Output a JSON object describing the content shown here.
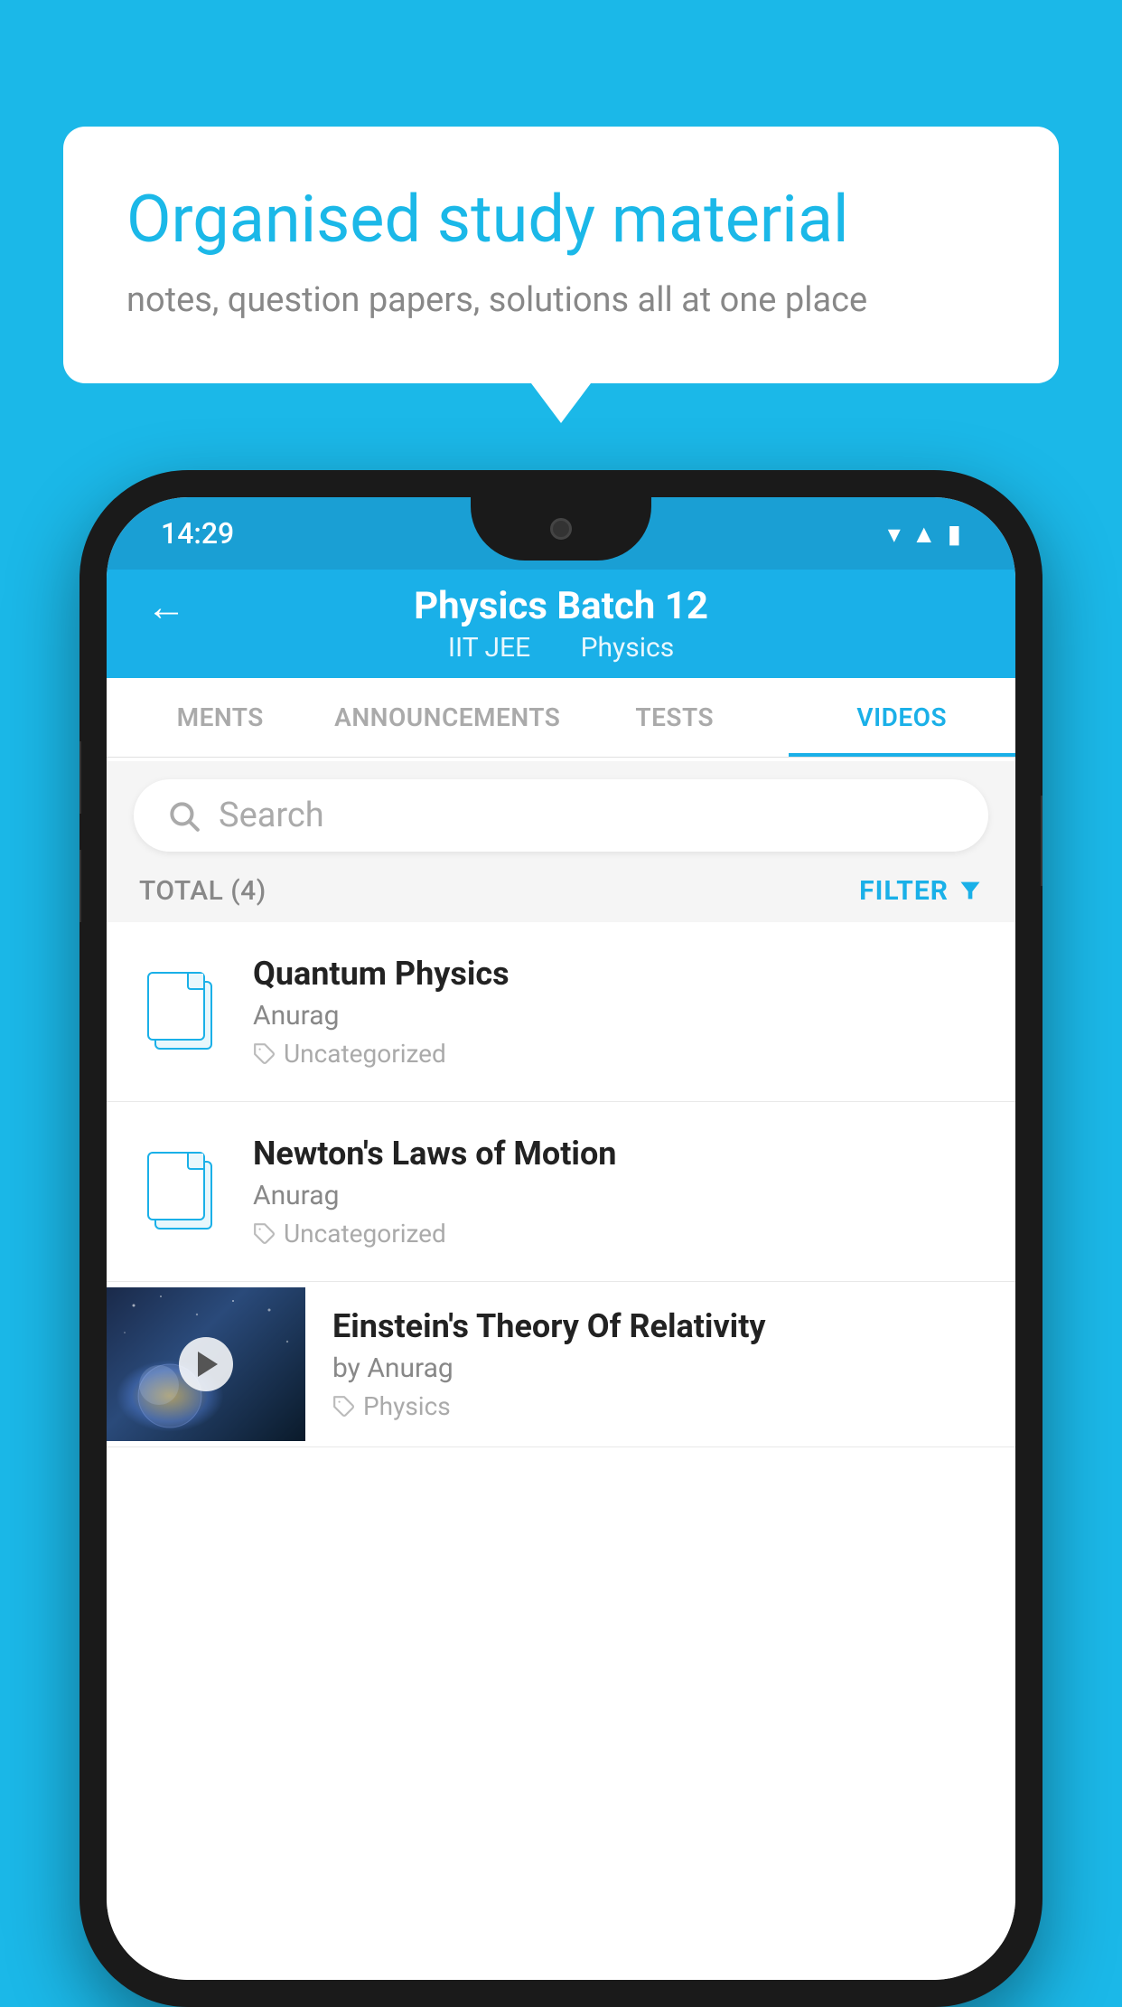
{
  "background_color": "#1BB8E8",
  "speech_bubble": {
    "title": "Organised study material",
    "subtitle": "notes, question papers, solutions all at one place"
  },
  "phone": {
    "status_bar": {
      "time": "14:29"
    },
    "header": {
      "back_label": "←",
      "title": "Physics Batch 12",
      "subtitle_part1": "IIT JEE",
      "subtitle_part2": "Physics"
    },
    "tabs": [
      {
        "label": "MENTS",
        "active": false
      },
      {
        "label": "ANNOUNCEMENTS",
        "active": false
      },
      {
        "label": "TESTS",
        "active": false
      },
      {
        "label": "VIDEOS",
        "active": true
      }
    ],
    "search": {
      "placeholder": "Search"
    },
    "filter": {
      "total_label": "TOTAL (4)",
      "filter_label": "FILTER"
    },
    "list_items": [
      {
        "title": "Quantum Physics",
        "author": "Anurag",
        "category": "Uncategorized",
        "type": "file"
      },
      {
        "title": "Newton's Laws of Motion",
        "author": "Anurag",
        "category": "Uncategorized",
        "type": "file"
      },
      {
        "title": "Einstein's Theory Of Relativity",
        "author": "by Anurag",
        "category": "Physics",
        "type": "video"
      }
    ]
  }
}
